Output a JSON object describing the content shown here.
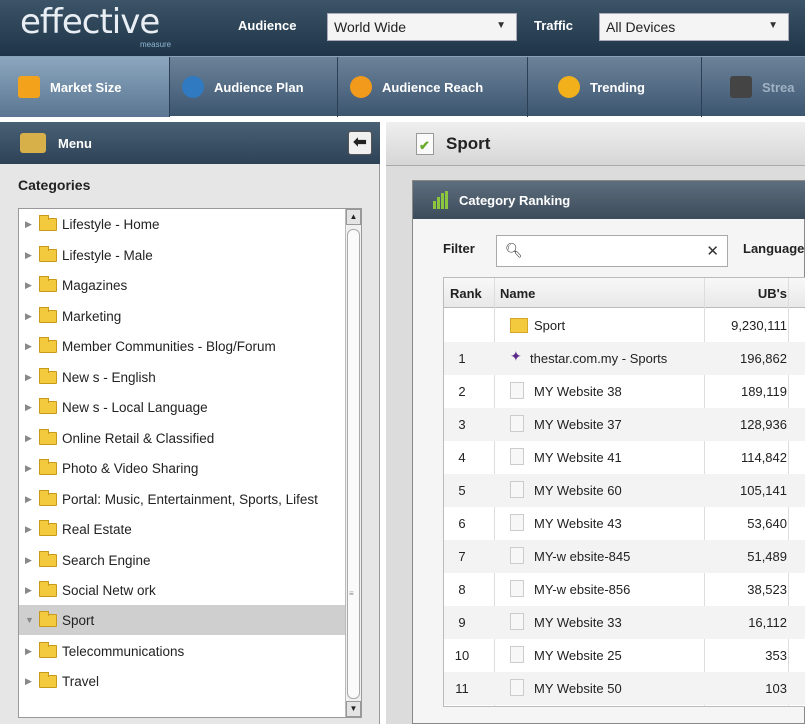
{
  "topbar": {
    "logo": "effective",
    "logo_sub": "measure",
    "audience_label": "Audience",
    "audience_value": "World Wide",
    "traffic_label": "Traffic",
    "traffic_value": "All Devices"
  },
  "nav": {
    "tabs": [
      {
        "label": "Market Size",
        "icon": "bar-chart-icon",
        "color": "#f2a31b"
      },
      {
        "label": "Audience Plan",
        "icon": "user-icon",
        "color": "#2f7ac0"
      },
      {
        "label": "Audience Reach",
        "icon": "pie-chart-icon",
        "color": "#f29a1b"
      },
      {
        "label": "Trending",
        "icon": "clock-icon",
        "color": "#f2b01b"
      },
      {
        "label": "Strea",
        "icon": "tv-icon",
        "color": "#444444"
      }
    ]
  },
  "menu": {
    "title": "Menu",
    "categories_title": "Categories",
    "items": [
      {
        "label": "Lifestyle - Home",
        "selected": false
      },
      {
        "label": "Lifestyle - Male",
        "selected": false
      },
      {
        "label": "Magazines",
        "selected": false
      },
      {
        "label": "Marketing",
        "selected": false
      },
      {
        "label": "Member Communities - Blog/Forum",
        "selected": false
      },
      {
        "label": "New s - English",
        "selected": false
      },
      {
        "label": "New s - Local Language",
        "selected": false
      },
      {
        "label": "Online Retail & Classified",
        "selected": false
      },
      {
        "label": "Photo & Video Sharing",
        "selected": false
      },
      {
        "label": "Portal: Music, Entertainment, Sports, Lifest",
        "selected": false
      },
      {
        "label": "Real Estate",
        "selected": false
      },
      {
        "label": "Search Engine",
        "selected": false
      },
      {
        "label": "Social Netw ork",
        "selected": false
      },
      {
        "label": "Sport",
        "selected": true
      },
      {
        "label": "Telecommunications",
        "selected": false
      },
      {
        "label": "Travel",
        "selected": false
      }
    ]
  },
  "main": {
    "title": "Sport",
    "panel_title": "Category Ranking",
    "filter_label": "Filter",
    "filter_value": "",
    "language_label": "Language",
    "columns": {
      "rank": "Rank",
      "name": "Name",
      "ubs": "UB's"
    },
    "rows": [
      {
        "rank": "",
        "name": "Sport",
        "ubs": "9,230,111",
        "icon": "folder-icon"
      },
      {
        "rank": "1",
        "name": "thestar.com.my - Sports",
        "ubs": "196,862",
        "icon": "site-logo-icon"
      },
      {
        "rank": "2",
        "name": "MY Website 38",
        "ubs": "189,119",
        "icon": "page-icon"
      },
      {
        "rank": "3",
        "name": "MY Website 37",
        "ubs": "128,936",
        "icon": "page-icon"
      },
      {
        "rank": "4",
        "name": "MY Website 41",
        "ubs": "114,842",
        "icon": "page-icon"
      },
      {
        "rank": "5",
        "name": "MY Website 60",
        "ubs": "105,141",
        "icon": "page-icon"
      },
      {
        "rank": "6",
        "name": "MY Website 43",
        "ubs": "53,640",
        "icon": "page-icon"
      },
      {
        "rank": "7",
        "name": "MY-w ebsite-845",
        "ubs": "51,489",
        "icon": "page-icon"
      },
      {
        "rank": "8",
        "name": "MY-w ebsite-856",
        "ubs": "38,523",
        "icon": "page-icon"
      },
      {
        "rank": "9",
        "name": "MY Website 33",
        "ubs": "16,112",
        "icon": "page-icon"
      },
      {
        "rank": "10",
        "name": "MY Website 25",
        "ubs": "353",
        "icon": "page-icon"
      },
      {
        "rank": "11",
        "name": "MY Website 50",
        "ubs": "103",
        "icon": "page-icon"
      }
    ]
  }
}
